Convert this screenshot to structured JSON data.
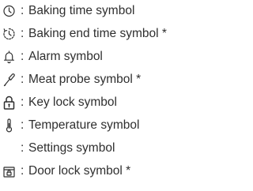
{
  "legend": {
    "separator": ":",
    "items": [
      {
        "icon": "clock-icon",
        "label": "Baking time symbol"
      },
      {
        "icon": "clock-end-icon",
        "label": "Baking end time symbol *"
      },
      {
        "icon": "bell-icon",
        "label": "Alarm symbol"
      },
      {
        "icon": "meat-probe-icon",
        "label": "Meat probe symbol *"
      },
      {
        "icon": "key-lock-icon",
        "label": "Key lock symbol"
      },
      {
        "icon": "thermometer-icon",
        "label": "Temperature symbol"
      },
      {
        "icon": "",
        "label": "Settings symbol"
      },
      {
        "icon": "door-lock-icon",
        "label": "Door lock symbol *"
      }
    ]
  }
}
